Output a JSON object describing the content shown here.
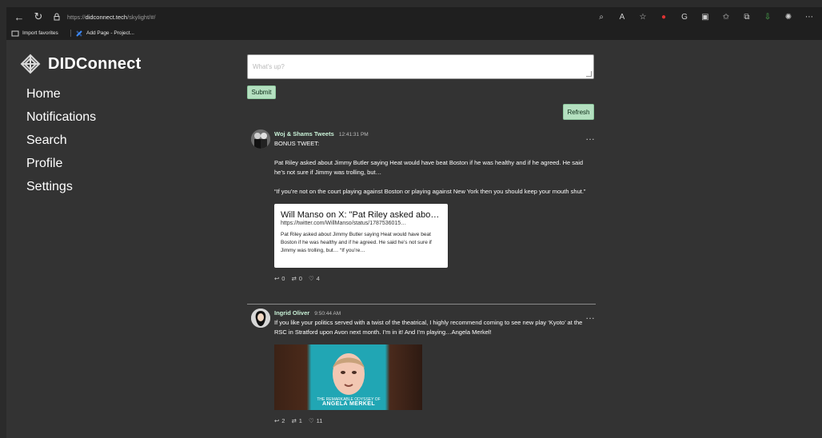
{
  "browser": {
    "url": {
      "proto": "https://",
      "host": "didconnect.tech",
      "path": "/skylight/#/"
    },
    "bookmarks": [
      {
        "label": "Import favorites"
      },
      {
        "label": "Add Page - Project..."
      }
    ],
    "icons": [
      "search-icon",
      "read-aloud-icon",
      "star-icon",
      "adblock-icon",
      "g-icon",
      "split-icon",
      "favorites-icon",
      "collections-icon",
      "download-icon",
      "copilot-icon",
      "more-icon"
    ]
  },
  "app": {
    "brand": {
      "name": "DIDConnect"
    },
    "nav": [
      {
        "label": "Home"
      },
      {
        "label": "Notifications"
      },
      {
        "label": "Search"
      },
      {
        "label": "Profile"
      },
      {
        "label": "Settings"
      }
    ],
    "composer": {
      "placeholder": "What's up?"
    },
    "buttons": {
      "submit": "Submit",
      "refresh": "Refresh"
    },
    "posts": [
      {
        "author": "Woj & Shams Tweets",
        "time": "12:41:31 PM",
        "lines": [
          "BONUS TWEET:",
          "Pat Riley asked about Jimmy Butler saying Heat would have beat Boston if he was healthy and if he agreed. He said he’s not sure if Jimmy was trolling, but…",
          "“If you’re not on the court playing against Boston or playing against New York then you should keep your mouth shut.”"
        ],
        "link_card": {
          "title": "Will Manso on X: \"Pat Riley asked abo…",
          "url": "https://twitter.com/WillManso/status/1787536015…",
          "desc": "Pat Riley asked about Jimmy Butler saying Heat would have beat Boston if he was healthy and if he agreed. He said he’s not sure if Jimmy was trolling, but… “If you’re…"
        },
        "actions": {
          "replies": "0",
          "reposts": "0",
          "likes": "4"
        }
      },
      {
        "author": "Ingrid Oliver",
        "time": "9:50:44 AM",
        "text": "If you like your politics served with a twist of the theatrical, I highly recommend coming to see new play ‘Kyoto’ at the RSC in Stratford upon Avon next month. I’m in it! And I’m playing…Angela Merkel!",
        "image_text": {
          "line1": "THE REMARKABLE ODYSSEY OF",
          "line2": "ANGELA MERKEL"
        },
        "actions": {
          "replies": "2",
          "reposts": "1",
          "likes": "11"
        }
      }
    ]
  }
}
